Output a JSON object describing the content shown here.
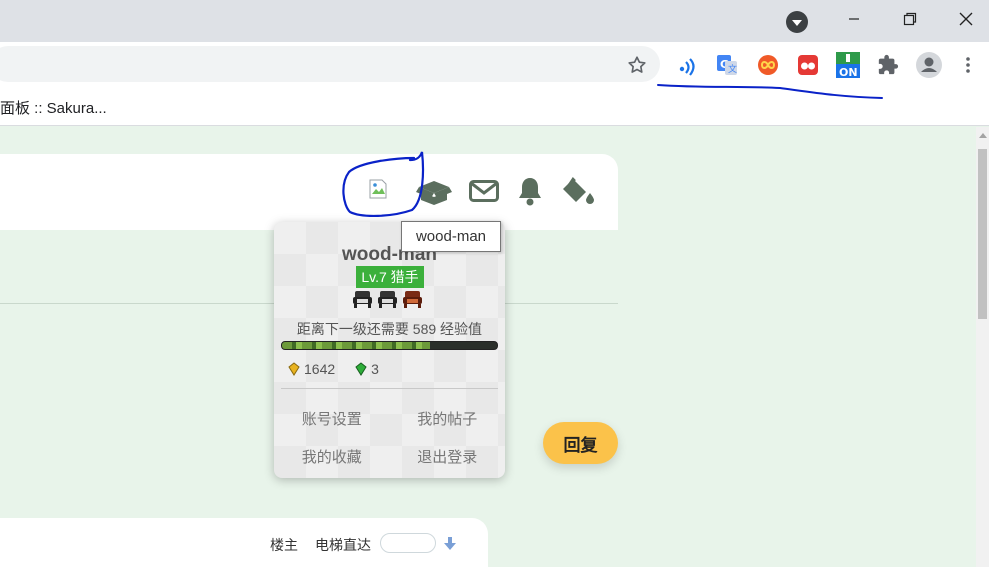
{
  "browser": {
    "bookmark_label": "面板 :: Sakura...",
    "extension_on_label": "ON"
  },
  "page": {
    "colors": {
      "background": "#e8f4ea",
      "accent": "#5b6e5e",
      "reply": "#fbc24a",
      "level": "#3bb03b"
    },
    "header_icons": [
      "broken-avatar-icon",
      "box-open-icon",
      "envelope-icon",
      "bell-icon",
      "paint-bucket-icon"
    ],
    "reply_label": "回复",
    "floor_owner_label": "楼主",
    "elevator_label": "电梯直达"
  },
  "profile": {
    "tooltip": "wood-man",
    "username": "wood-man",
    "level": "Lv.7 猎手",
    "exp_text": "距离下一级还需要 589 经验值",
    "exp_progress": 0.69,
    "coins": "1642",
    "gems": "3",
    "menu": [
      "账号设置",
      "我的帖子",
      "我的收藏",
      "退出登录"
    ]
  }
}
